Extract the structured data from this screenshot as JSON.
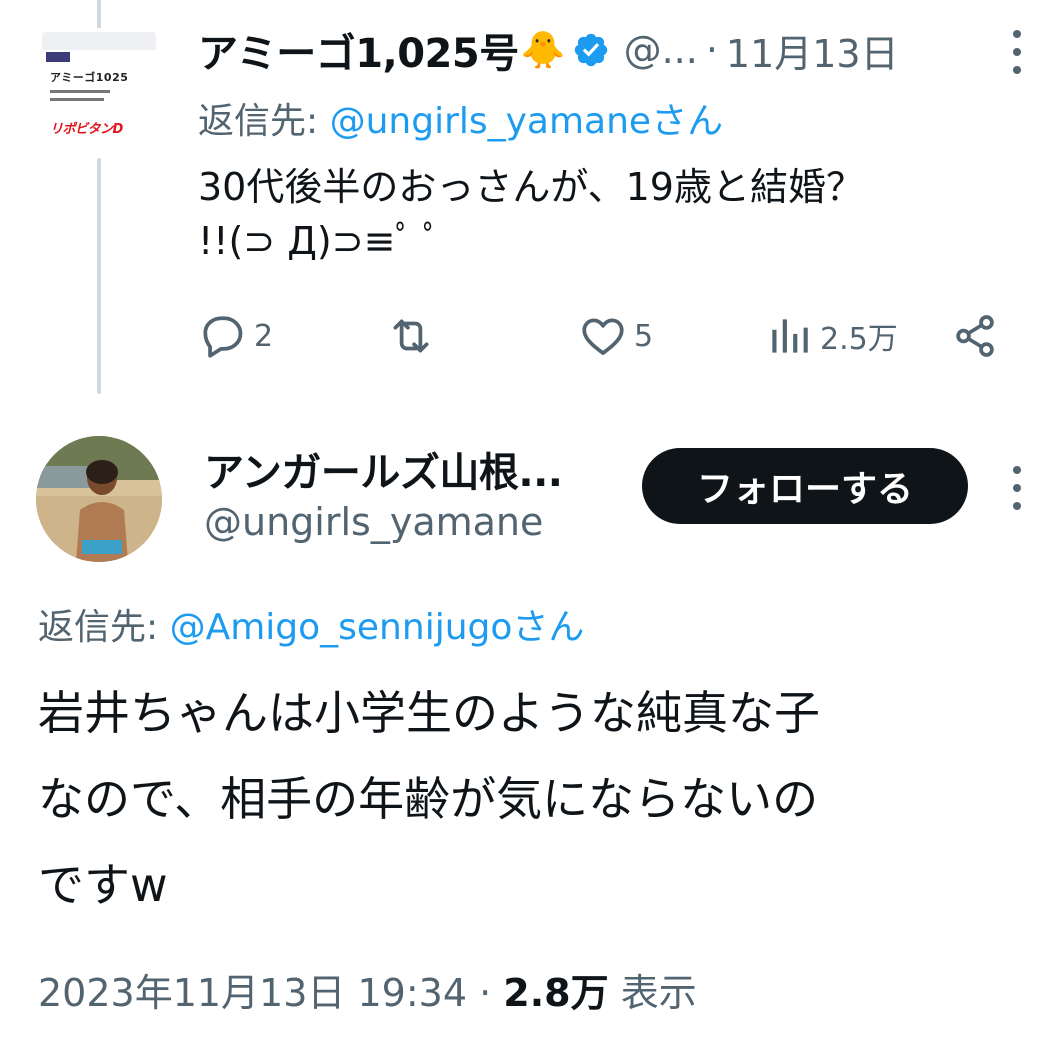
{
  "colors": {
    "text": "#0f1419",
    "muted": "#536471",
    "link": "#1d9bf0",
    "verified": "#1d9bf0",
    "thread_line": "#cfd9de",
    "follow_bg": "#0f1419",
    "follow_text": "#ffffff"
  },
  "parent_tweet": {
    "avatar": {
      "name_text": "アミーゴ1025",
      "logo_text": "リポビタンD"
    },
    "display_name": "アミーゴ1,025号",
    "emoji": "🐥",
    "handle": "@...",
    "separator": "·",
    "date": "11月13日",
    "reply_label": "返信先: ",
    "reply_mention": "@ungirls_yamane",
    "reply_suffix": "さん",
    "text_line1": "30代後半のおっさんが、19歳と結婚？",
    "text_line2": "!!(⊃ Д)⊃≡ﾟ ﾟ",
    "actions": {
      "reply_icon": "reply-icon",
      "reply_count": "2",
      "retweet_icon": "retweet-icon",
      "like_icon": "heart-icon",
      "like_count": "5",
      "views_icon": "views-icon",
      "views_count": "2.5万",
      "share_icon": "share-icon"
    }
  },
  "main_tweet": {
    "display_name": "アンガールズ山根...",
    "handle": "@ungirls_yamane",
    "follow_label": "フォローする",
    "reply_label": "返信先: ",
    "reply_mention": "@Amigo_sennijugo",
    "reply_suffix": "さん",
    "text_line1": "岩井ちゃんは小学生のような純真な子",
    "text_line2": "なので、相手の年齢が気にならないの",
    "text_line3": "ですw",
    "timestamp": "2023年11月13日 19:34",
    "separator": " · ",
    "views": "2.8万",
    "views_label": "表示"
  }
}
